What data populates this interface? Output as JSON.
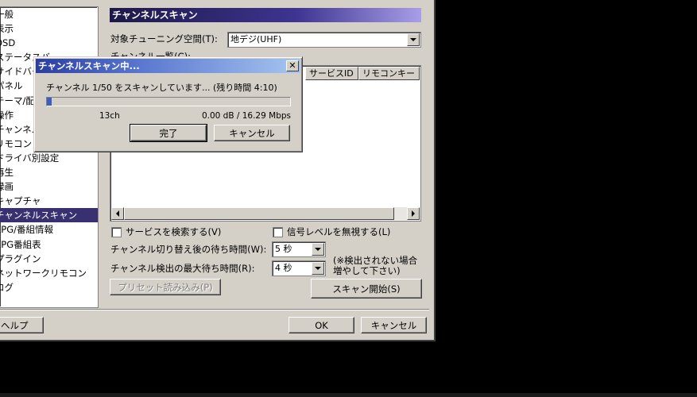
{
  "sidebar": {
    "items": [
      {
        "label": "一般",
        "selected": false
      },
      {
        "label": "表示",
        "selected": false
      },
      {
        "label": "OSD",
        "selected": false
      },
      {
        "label": "ステータスバー",
        "selected": false
      },
      {
        "label": "サイドバー",
        "selected": false
      },
      {
        "label": "パネル",
        "selected": false
      },
      {
        "label": "テーマ/配色",
        "selected": false
      },
      {
        "label": "操作",
        "selected": false
      },
      {
        "label": "チャンネル割り当て",
        "selected": false
      },
      {
        "label": "リモコン",
        "selected": false
      },
      {
        "label": "ドライバ別設定",
        "selected": false
      },
      {
        "label": "再生",
        "selected": false
      },
      {
        "label": "録画",
        "selected": false
      },
      {
        "label": "キャプチャ",
        "selected": false
      },
      {
        "label": "チャンネルスキャン",
        "selected": true
      },
      {
        "label": "EPG/番組情報",
        "selected": false
      },
      {
        "label": "EPG番組表",
        "selected": false
      },
      {
        "label": "プラグイン",
        "selected": false
      },
      {
        "label": "ネットワークリモコン",
        "selected": false
      },
      {
        "label": "ログ",
        "selected": false
      }
    ]
  },
  "main": {
    "section_title": "チャンネルスキャン",
    "tuning_space_label": "対象チューニング空間(T):",
    "tuning_space_value": "地デジ(UHF)",
    "channel_list_label": "チャンネル一覧(C):",
    "columns": [
      "サービスID",
      "リモコンキー"
    ],
    "search_services_label": "サービスを検索する(V)",
    "search_services_checked": false,
    "ignore_signal_label": "信号レベルを無視する(L)",
    "ignore_signal_checked": false,
    "wait_after_switch_label": "チャンネル切り替え後の待ち時間(W):",
    "wait_after_switch_value": "5 秒",
    "max_wait_label": "チャンネル検出の最大待ち時間(R):",
    "max_wait_value": "4 秒",
    "note_line1": "(※検出されない場合",
    "note_line2": "増やして下さい)",
    "load_preset_label": "プリセット読み込み(P)",
    "start_scan_label": "スキャン開始(S)"
  },
  "footer": {
    "help_label": "ヘルプ",
    "ok_label": "OK",
    "cancel_label": "キャンセル"
  },
  "progress_dialog": {
    "title": "チャンネルスキャン中...",
    "status_text": "チャンネル 1/50 をスキャンしています... (残り時間 4:10)",
    "progress_fraction": 0.02,
    "channel": "13ch",
    "signal": "0.00 dB / 16.29 Mbps",
    "done_label": "完了",
    "cancel_label": "キャンセル"
  },
  "colors": {
    "face": "#d4d0c8",
    "selection": "#383070",
    "progress": "#3a5fc0"
  }
}
